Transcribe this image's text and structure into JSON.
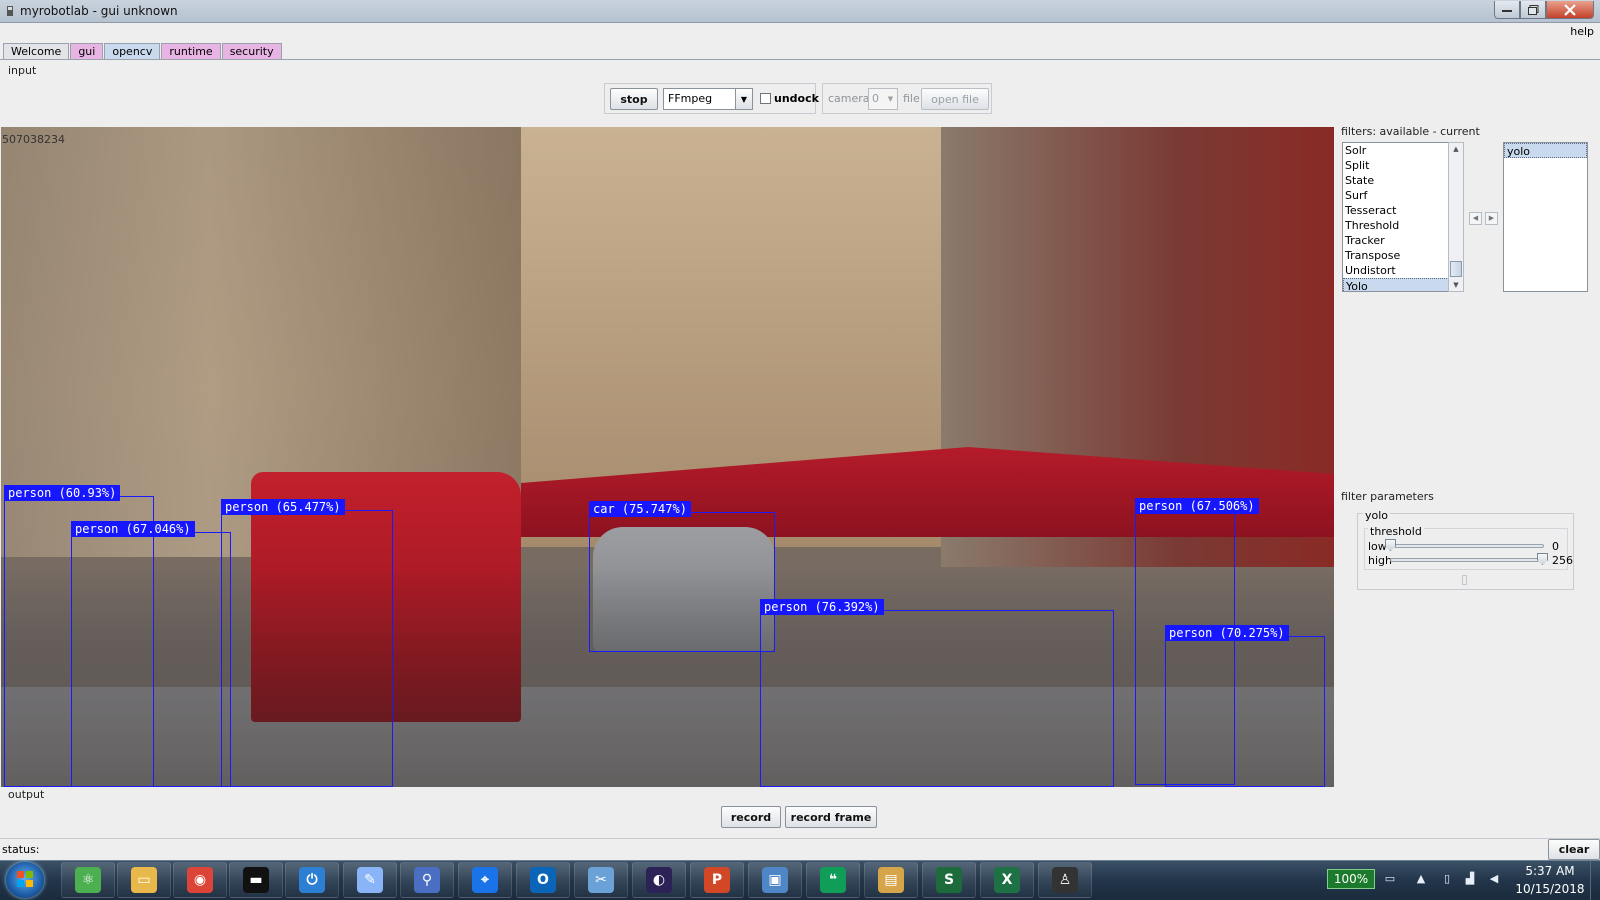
{
  "window": {
    "title": "myrobotlab - gui unknown",
    "help_label": "help"
  },
  "tabs": [
    {
      "label": "Welcome"
    },
    {
      "label": "gui"
    },
    {
      "label": "opencv"
    },
    {
      "label": "runtime"
    },
    {
      "label": "security"
    }
  ],
  "input": {
    "group_label": "input",
    "stop_label": "stop",
    "source_selected": "FFmpeg",
    "undock_label": "undock",
    "camera_label": "camera",
    "camera_value": "0",
    "file_label": "file",
    "open_file_label": "open file"
  },
  "video": {
    "frame_counter": "507038234",
    "detections": [
      {
        "label": "person (60.93%)"
      },
      {
        "label": "person (67.046%)"
      },
      {
        "label": "person (65.477%)"
      },
      {
        "label": "car (75.747%)"
      },
      {
        "label": "person (76.392%)"
      },
      {
        "label": "person (67.506%)"
      },
      {
        "label": "person (70.275%)"
      }
    ]
  },
  "filters": {
    "label": "filters: available - current",
    "available": [
      "Solr",
      "Split",
      "State",
      "Surf",
      "Tesseract",
      "Threshold",
      "Tracker",
      "Transpose",
      "Undistort",
      "Yolo"
    ],
    "available_selected": "Yolo",
    "current": [
      "yolo"
    ]
  },
  "filter_parameters": {
    "label": "filter parameters",
    "filter_name": "yolo",
    "threshold_label": "threshold",
    "low_label": "low",
    "low_value": "0",
    "high_label": "high",
    "high_value": "256"
  },
  "output": {
    "group_label": "output",
    "record_label": "record",
    "record_frame_label": "record frame"
  },
  "status": {
    "label": "status:",
    "clear_label": "clear"
  },
  "taskbar": {
    "battery_percent": "100%",
    "time": "5:37 AM",
    "date": "10/15/2018",
    "apps": [
      {
        "name": "atom-icon",
        "color": "#4caf50",
        "glyph": "⚛"
      },
      {
        "name": "folder-icon",
        "color": "#e8b84a",
        "glyph": "▭"
      },
      {
        "name": "chrome-icon",
        "color": "#db4437",
        "glyph": "◉"
      },
      {
        "name": "terminal-icon",
        "color": "#111111",
        "glyph": "▬"
      },
      {
        "name": "power-icon",
        "color": "#2d7fd3",
        "glyph": "⏻"
      },
      {
        "name": "paint-icon",
        "color": "#8ab4f8",
        "glyph": "✎"
      },
      {
        "name": "binoculars-icon",
        "color": "#4a6fc2",
        "glyph": "⚲"
      },
      {
        "name": "maps-pin-icon",
        "color": "#1a73e8",
        "glyph": "⌖"
      },
      {
        "name": "outlook-icon",
        "color": "#0a64b8",
        "glyph": "O"
      },
      {
        "name": "snipping-icon",
        "color": "#6aa2d8",
        "glyph": "✂"
      },
      {
        "name": "eclipse-icon",
        "color": "#2c2255",
        "glyph": "◐"
      },
      {
        "name": "powerpoint-icon",
        "color": "#d24726",
        "glyph": "P"
      },
      {
        "name": "photo-viewer-icon",
        "color": "#4f86c6",
        "glyph": "▣"
      },
      {
        "name": "hangouts-icon",
        "color": "#0f9d58",
        "glyph": "❝"
      },
      {
        "name": "clipboard-icon",
        "color": "#d6a54a",
        "glyph": "▤"
      },
      {
        "name": "sigma-s-icon",
        "color": "#1d6b3a",
        "glyph": "S"
      },
      {
        "name": "excel-icon",
        "color": "#1e7145",
        "glyph": "X"
      },
      {
        "name": "inkscape-icon",
        "color": "#333333",
        "glyph": "♙"
      }
    ]
  }
}
